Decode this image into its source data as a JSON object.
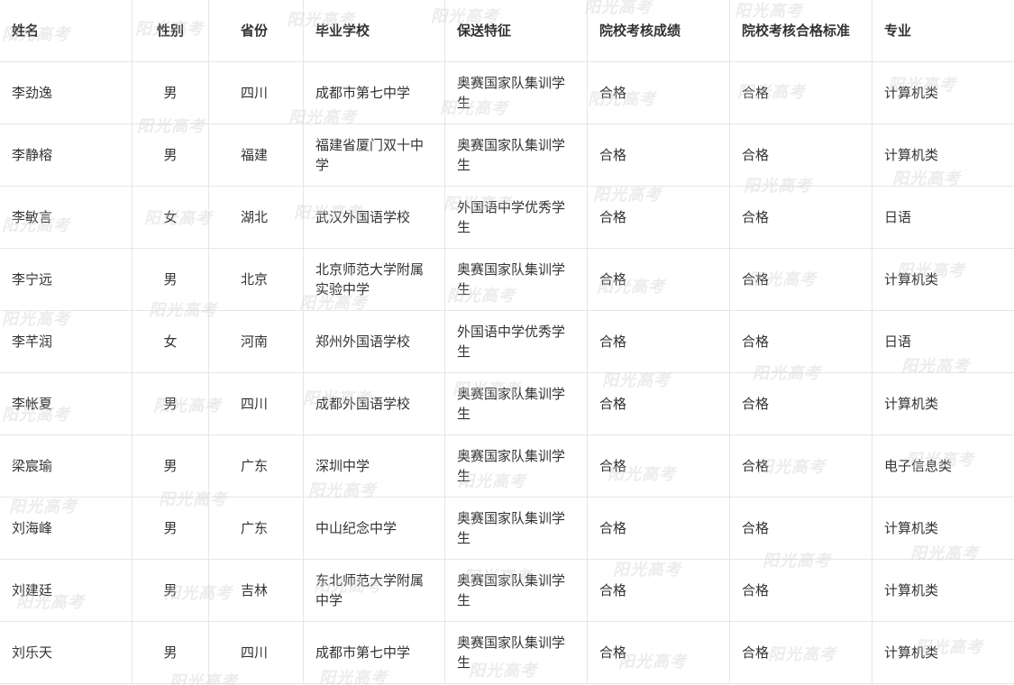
{
  "table": {
    "headers": [
      "姓名",
      "性别",
      "省份",
      "毕业学校",
      "保送特征",
      "院校考核成绩",
      "院校考核合格标准",
      "专业"
    ],
    "rows": [
      [
        "李劲逸",
        "男",
        "四川",
        "成都市第七中学",
        "奥赛国家队集训学生",
        "合格",
        "合格",
        "计算机类"
      ],
      [
        "李静榕",
        "男",
        "福建",
        "福建省厦门双十中学",
        "奥赛国家队集训学生",
        "合格",
        "合格",
        "计算机类"
      ],
      [
        "李敏言",
        "女",
        "湖北",
        "武汉外国语学校",
        "外国语中学优秀学生",
        "合格",
        "合格",
        "日语"
      ],
      [
        "李宁远",
        "男",
        "北京",
        "北京师范大学附属实验中学",
        "奥赛国家队集训学生",
        "合格",
        "合格",
        "计算机类"
      ],
      [
        "李芊润",
        "女",
        "河南",
        "郑州外国语学校",
        "外国语中学优秀学生",
        "合格",
        "合格",
        "日语"
      ],
      [
        "李帐夏",
        "男",
        "四川",
        "成都外国语学校",
        "奥赛国家队集训学生",
        "合格",
        "合格",
        "计算机类"
      ],
      [
        "梁宸瑜",
        "男",
        "广东",
        "深圳中学",
        "奥赛国家队集训学生",
        "合格",
        "合格",
        "电子信息类"
      ],
      [
        "刘海峰",
        "男",
        "广东",
        "中山纪念中学",
        "奥赛国家队集训学生",
        "合格",
        "合格",
        "计算机类"
      ],
      [
        "刘建廷",
        "男",
        "吉林",
        "东北师范大学附属中学",
        "奥赛国家队集训学生",
        "合格",
        "合格",
        "计算机类"
      ],
      [
        "刘乐天",
        "男",
        "四川",
        "成都市第七中学",
        "奥赛国家队集训学生",
        "合格",
        "合格",
        "计算机类"
      ]
    ]
  },
  "watermark": {
    "text": "阳光高考",
    "color": "#c8c8c8"
  }
}
